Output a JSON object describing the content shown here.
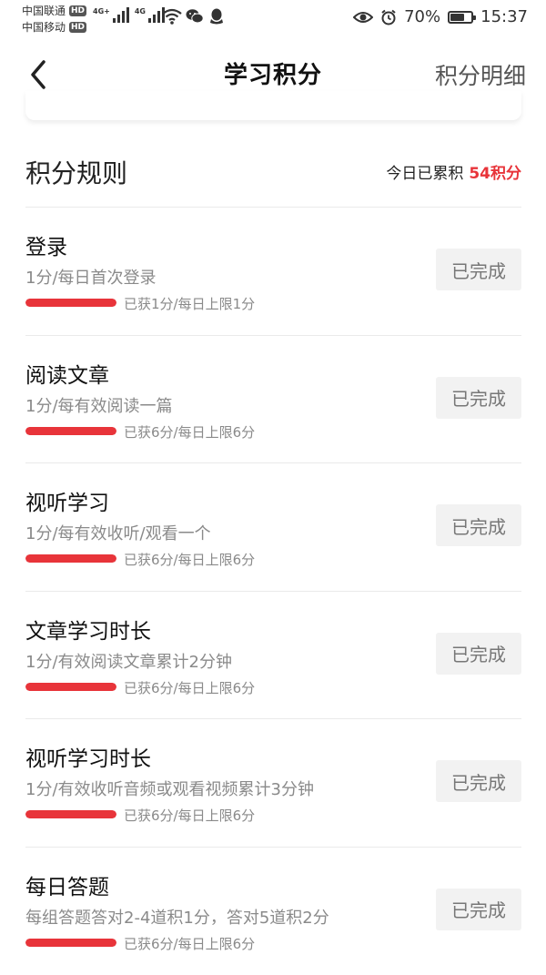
{
  "status_bar": {
    "carrier1": "中国联通",
    "carrier2": "中国移动",
    "hd_badge": "HD",
    "network1": "4G+",
    "network2": "4G",
    "battery_percent_text": "70%",
    "battery_level": 0.7,
    "time": "15:37"
  },
  "header": {
    "title": "学习积分",
    "detail_link": "积分明细"
  },
  "rules": {
    "title": "积分规则",
    "today_label": "今日已累积",
    "today_points": "54积分"
  },
  "items": [
    {
      "name": "登录",
      "desc": "1分/每日首次登录",
      "progress_text": "已获1分/每日上限1分",
      "progress": 1.0,
      "button": "已完成"
    },
    {
      "name": "阅读文章",
      "desc": "1分/每有效阅读一篇",
      "progress_text": "已获6分/每日上限6分",
      "progress": 1.0,
      "button": "已完成"
    },
    {
      "name": "视听学习",
      "desc": "1分/每有效收听/观看一个",
      "progress_text": "已获6分/每日上限6分",
      "progress": 1.0,
      "button": "已完成"
    },
    {
      "name": "文章学习时长",
      "desc": "1分/有效阅读文章累计2分钟",
      "progress_text": "已获6分/每日上限6分",
      "progress": 1.0,
      "button": "已完成"
    },
    {
      "name": "视听学习时长",
      "desc": "1分/有效收听音频或观看视频累计3分钟",
      "progress_text": "已获6分/每日上限6分",
      "progress": 1.0,
      "button": "已完成"
    },
    {
      "name": "每日答题",
      "desc": "每组答题答对2-4道积1分，答对5道积2分",
      "progress_text": "已获6分/每日上限6分",
      "progress": 1.0,
      "button": "已完成"
    }
  ],
  "colors": {
    "accent": "#e8343a",
    "button_bg": "#f2f2f2"
  }
}
